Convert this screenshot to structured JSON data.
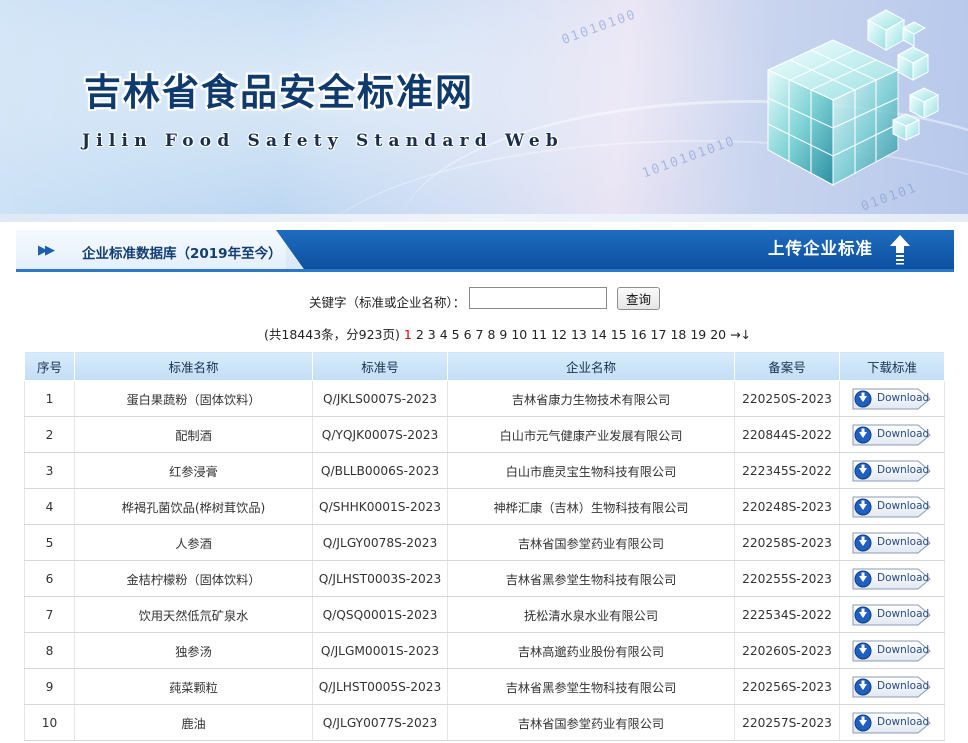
{
  "header": {
    "title": "吉林省食品安全标准网",
    "subtitle": "Jilin Food Safety Standard Web"
  },
  "section": {
    "title": "企业标准数据库（2019年至今）",
    "upload_label": "上传企业标准"
  },
  "search": {
    "label": "关键字（标准或企业名称）：",
    "value": "",
    "button_label": "查询"
  },
  "pagination": {
    "summary": "(共18443条，分923页)",
    "pages": [
      "1",
      "2",
      "3",
      "4",
      "5",
      "6",
      "7",
      "8",
      "9",
      "10",
      "11",
      "12",
      "13",
      "14",
      "15",
      "16",
      "17",
      "18",
      "19",
      "20"
    ],
    "current": "1",
    "next_symbol": "→",
    "last_symbol": "↓"
  },
  "table": {
    "columns": [
      "序号",
      "标准名称",
      "标准号",
      "企业名称",
      "备案号",
      "下载标准"
    ],
    "download_label": "Download",
    "rows": [
      [
        "1",
        "蛋白果蔬粉（固体饮料）",
        "Q/JKLS0007S-2023",
        "吉林省康力生物技术有限公司",
        "220250S-2023"
      ],
      [
        "2",
        "配制酒",
        "Q/YQJK0007S-2023",
        "白山市元气健康产业发展有限公司",
        "220844S-2022"
      ],
      [
        "3",
        "红参浸膏",
        "Q/BLLB0006S-2023",
        "白山市鹿灵宝生物科技有限公司",
        "222345S-2022"
      ],
      [
        "4",
        "桦褐孔菌饮品(桦树茸饮品)",
        "Q/SHHK0001S-2023",
        "神桦汇康（吉林）生物科技有限公司",
        "220248S-2023"
      ],
      [
        "5",
        "人参酒",
        "Q/JLGY0078S-2023",
        "吉林省国参堂药业有限公司",
        "220258S-2023"
      ],
      [
        "6",
        "金桔柠檬粉（固体饮料）",
        "Q/JLHST0003S-2023",
        "吉林省黑参堂生物科技有限公司",
        "220255S-2023"
      ],
      [
        "7",
        "饮用天然低氘矿泉水",
        "Q/QSQ0001S-2023",
        "抚松清水泉水业有限公司",
        "222534S-2022"
      ],
      [
        "8",
        "独参汤",
        "Q/JLGM0001S-2023",
        "吉林高邈药业股份有限公司",
        "220260S-2023"
      ],
      [
        "9",
        "莼菜颗粒",
        "Q/JLHST0005S-2023",
        "吉林省黑参堂生物科技有限公司",
        "220256S-2023"
      ],
      [
        "10",
        "鹿油",
        "Q/JLGY0077S-2023",
        "吉林省国参堂药业有限公司",
        "220257S-2023"
      ]
    ]
  }
}
